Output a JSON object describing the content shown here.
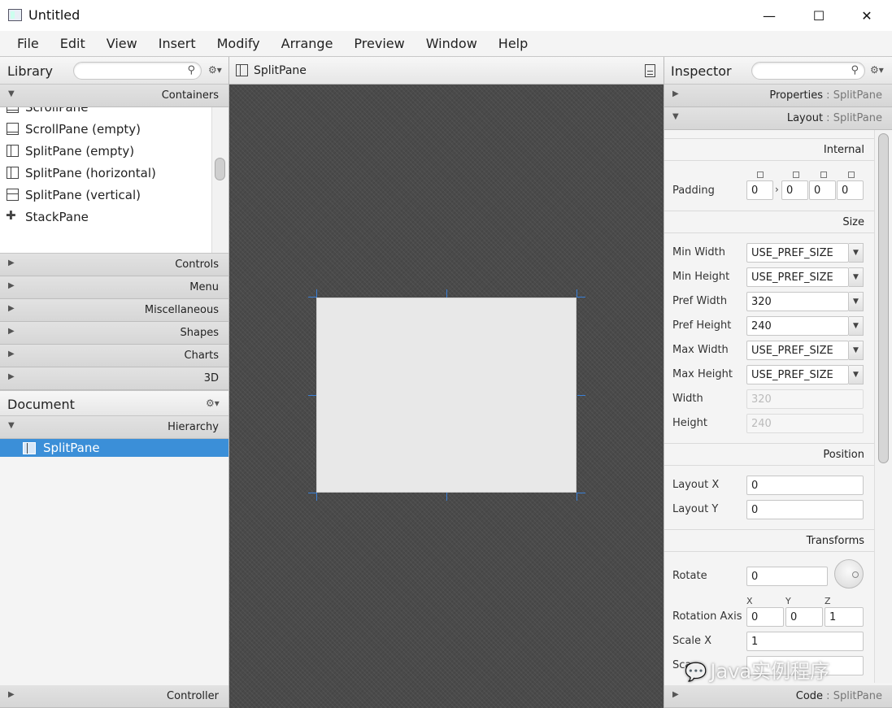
{
  "window": {
    "title": "Untitled",
    "minimize": "—",
    "maximize": "☐",
    "close": "✕"
  },
  "menu": [
    "File",
    "Edit",
    "View",
    "Insert",
    "Modify",
    "Arrange",
    "Preview",
    "Window",
    "Help"
  ],
  "library": {
    "title": "Library",
    "search_placeholder": "",
    "open_section": "Containers",
    "items": [
      {
        "label": "ScrollPane"
      },
      {
        "label": "ScrollPane  (empty)"
      },
      {
        "label": "SplitPane  (empty)"
      },
      {
        "label": "SplitPane  (horizontal)"
      },
      {
        "label": "SplitPane  (vertical)"
      },
      {
        "label": "StackPane"
      }
    ],
    "sections": [
      "Controls",
      "Menu",
      "Miscellaneous",
      "Shapes",
      "Charts",
      "3D"
    ]
  },
  "document": {
    "title": "Document",
    "hierarchy_label": "Hierarchy",
    "selected_node": "SplitPane",
    "controller_label": "Controller"
  },
  "canvas": {
    "title": "SplitPane"
  },
  "inspector": {
    "title": "Inspector",
    "properties": {
      "key": "Properties",
      "sep": " : ",
      "val": "SplitPane"
    },
    "layout": {
      "key": "Layout",
      "sep": " : ",
      "val": "SplitPane"
    },
    "code": {
      "key": "Code",
      "sep": " : ",
      "val": "SplitPane"
    },
    "internal_header": "Internal",
    "padding_label": "Padding",
    "padding": [
      "0",
      "0",
      "0",
      "0"
    ],
    "size_header": "Size",
    "size_rows": [
      {
        "label": "Min Width",
        "value": "USE_PREF_SIZE"
      },
      {
        "label": "Min Height",
        "value": "USE_PREF_SIZE"
      },
      {
        "label": "Pref Width",
        "value": "320"
      },
      {
        "label": "Pref Height",
        "value": "240"
      },
      {
        "label": "Max Width",
        "value": "USE_PREF_SIZE"
      },
      {
        "label": "Max Height",
        "value": "USE_PREF_SIZE"
      }
    ],
    "width_label": "Width",
    "width_value": "320",
    "height_label": "Height",
    "height_value": "240",
    "position_header": "Position",
    "layout_x_label": "Layout X",
    "layout_x": "0",
    "layout_y_label": "Layout Y",
    "layout_y": "0",
    "transforms_header": "Transforms",
    "rotate_label": "Rotate",
    "rotate": "0",
    "axis_labels": [
      "X",
      "Y",
      "Z"
    ],
    "rotation_axis_label": "Rotation Axis",
    "rotation_axis": [
      "0",
      "0",
      "1"
    ],
    "scale_x_label": "Scale X",
    "scale_x": "1",
    "scale_y_label": "Sca"
  },
  "watermark": "Java实例程序",
  "colors": {
    "selection": "#3b8fd8",
    "canvas": "#4a4a4a",
    "handle": "#3a7fd5"
  }
}
